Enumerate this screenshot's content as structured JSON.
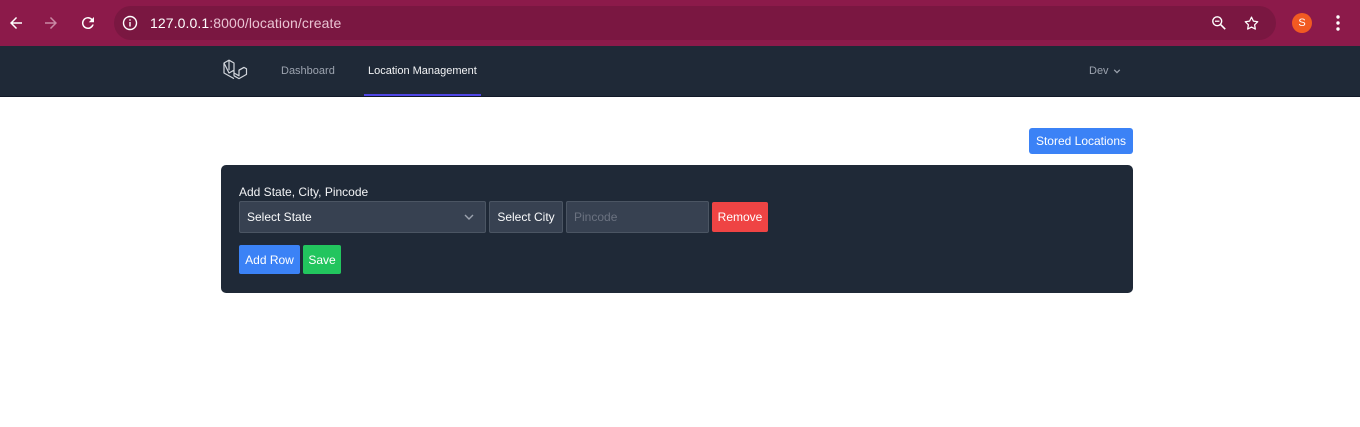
{
  "browser": {
    "url_host": "127.0.0.1",
    "url_path": ":8000/location/create",
    "profile_initial": "S",
    "icons": {
      "back": "arrow-left-icon",
      "forward": "arrow-right-icon",
      "reload": "reload-icon",
      "site_info": "info-icon",
      "zoom": "zoom-icon",
      "bookmark": "star-icon",
      "menu": "kebab-menu-icon"
    }
  },
  "nav": {
    "links": [
      {
        "label": "Dashboard",
        "active": false
      },
      {
        "label": "Location Management",
        "active": true
      }
    ],
    "user_label": "Dev"
  },
  "actions": {
    "stored_locations_label": "Stored Locations"
  },
  "form": {
    "heading": "Add State, City, Pincode",
    "state_select_value": "Select State",
    "city_select_value": "Select City",
    "pincode_placeholder": "Pincode",
    "remove_label": "Remove",
    "add_row_label": "Add Row",
    "save_label": "Save"
  },
  "colors": {
    "browser_bar": "#8c1a4a",
    "nav_bg": "#1f2937",
    "primary": "#3b82f6",
    "danger": "#ef4444",
    "success": "#22c55e"
  }
}
